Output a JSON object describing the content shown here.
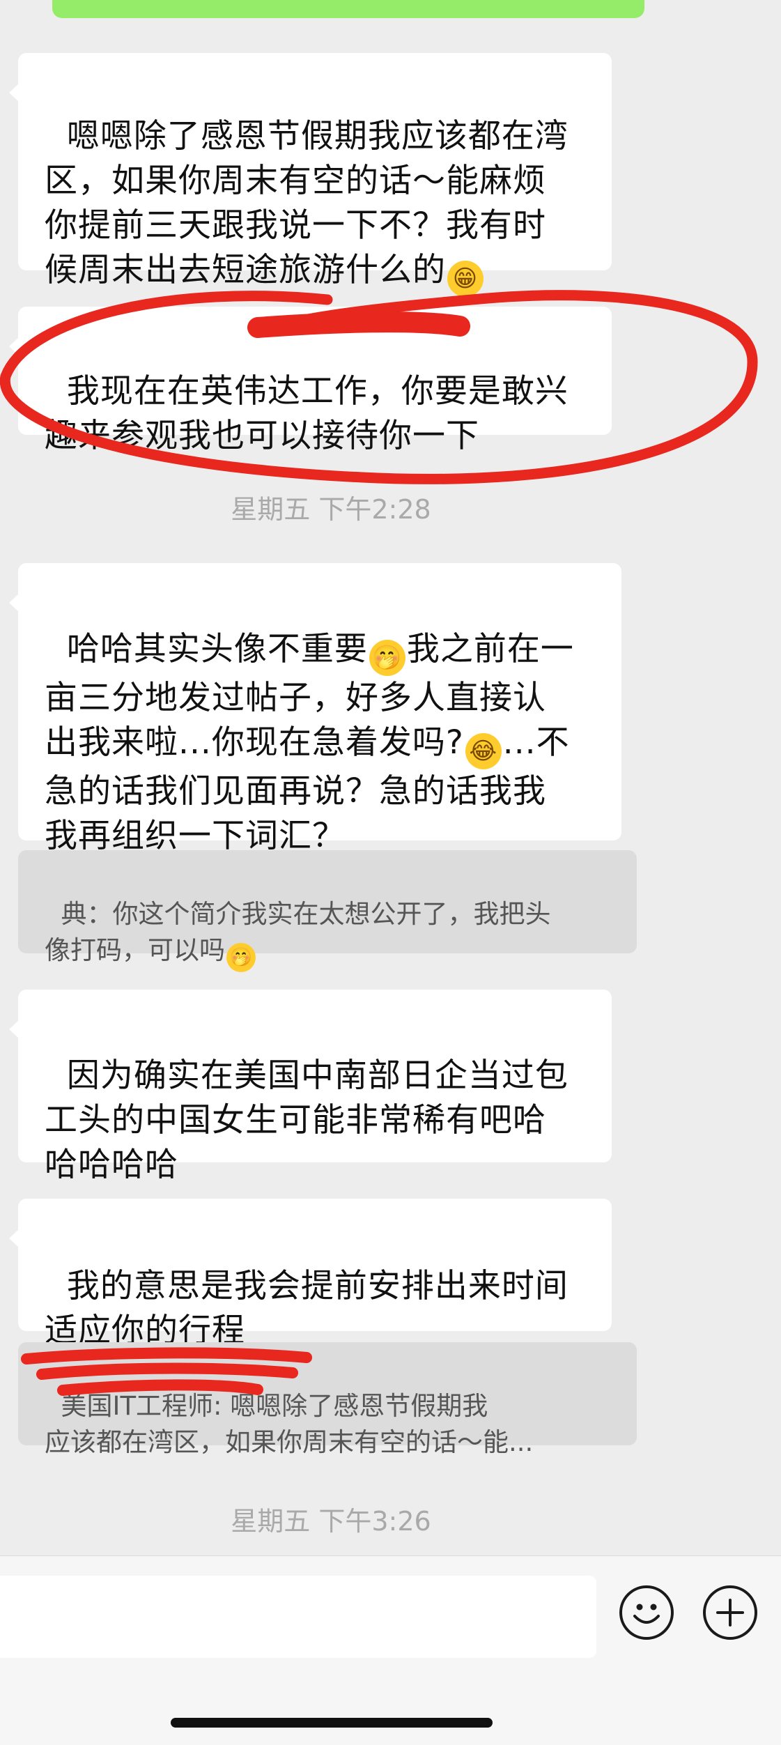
{
  "messages": [
    {
      "text": "嗯嗯除了感恩节假期我应该都在湾\n区，如果你周末有空的话～能麻烦\n你提前三天跟我说一下不？我有时\n候周末出去短途旅游什么的",
      "emoji": "😁"
    },
    {
      "text": "我现在在英伟达工作，你要是敢兴\n趣来参观我也可以接待你一下"
    },
    {
      "timestamp": "星期五 下午2:28"
    },
    {
      "text_a": "哈哈其实头像不重要",
      "emoji_a": "🤭",
      "text_b": "我之前在一\n亩三分地发过帖子，好多人直接认\n出我来啦...你现在急着发吗?",
      "emoji_b": "😂",
      "text_c": "...不\n急的话我们见面再说？急的话我我\n我再组织一下词汇？"
    },
    {
      "quote_text": "典：你这个简介我实在太想公开了，我把头\n像打码，可以吗",
      "quote_emoji": "🤭"
    },
    {
      "text": "因为确实在美国中南部日企当过包\n工头的中国女生可能非常稀有吧哈\n哈哈哈哈"
    },
    {
      "text": "我的意思是我会提前安排出来时间\n适应你的行程"
    },
    {
      "quote_text": "美国IT工程师: 嗯嗯除了感恩节假期我\n应该都在湾区，如果你周末有空的话～能..."
    },
    {
      "timestamp": "星期五 下午3:26"
    }
  ],
  "annotation_colors": {
    "red_mark": "#e8271e"
  },
  "accent_color": "#95ec69",
  "icons": {
    "emoji_button": "smiley-icon",
    "more_button": "plus-icon"
  }
}
